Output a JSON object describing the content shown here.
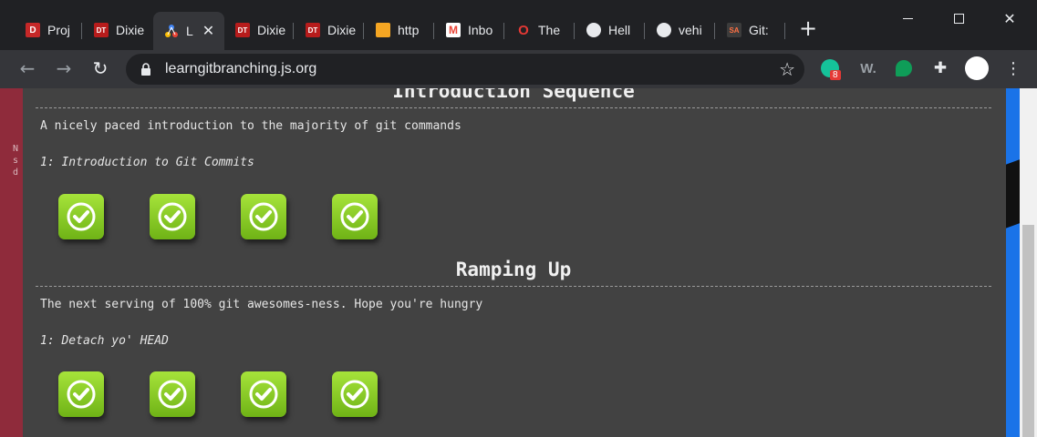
{
  "tabs": [
    {
      "label": "Proj",
      "favicon": "dixie-d-icon",
      "color": "#e53935"
    },
    {
      "label": "Dixie",
      "favicon": "dt-icon",
      "color": "#e53935"
    },
    {
      "label": "L",
      "favicon": "learngitbranching-icon",
      "color": "#4285f4",
      "active": true
    },
    {
      "label": "Dixie",
      "favicon": "dt-icon",
      "color": "#e53935"
    },
    {
      "label": "Dixie",
      "favicon": "dt-icon",
      "color": "#e53935"
    },
    {
      "label": "http",
      "favicon": "amazon-box-icon",
      "color": "#f5a623"
    },
    {
      "label": "Inbo",
      "favicon": "gmail-icon",
      "color": "#ea4335"
    },
    {
      "label": "The",
      "favicon": "opera-icon",
      "color": "#e53935"
    },
    {
      "label": "Hell",
      "favicon": "github-icon",
      "color": "#e8eaed"
    },
    {
      "label": "vehi",
      "favicon": "github-icon",
      "color": "#e8eaed"
    },
    {
      "label": "Git:",
      "favicon": "sa-icon",
      "color": "#ff7043"
    }
  ],
  "toolbar": {
    "url": "learngitbranching.js.org",
    "extension_badge": "8",
    "ext_w_label": "W."
  },
  "modal": {
    "sections": [
      {
        "title": "Introduction Sequence",
        "description": "A nicely paced introduction to the majority of git commands",
        "level_name": "1: Introduction to Git Commits",
        "levels_completed": [
          true,
          true,
          true,
          true
        ]
      },
      {
        "title": "Ramping Up",
        "description": "The next serving of 100% git awesomes-ness. Hope you're hungry",
        "level_name": "1: Detach yo' HEAD",
        "levels_completed": [
          true,
          true,
          true,
          true
        ]
      }
    ]
  },
  "background": {
    "left_text": [
      "N",
      "s",
      "d"
    ]
  },
  "colors": {
    "level_complete": "#8cc63f",
    "modal_bg": "#424242",
    "page_bg": "#8f2b3b"
  }
}
